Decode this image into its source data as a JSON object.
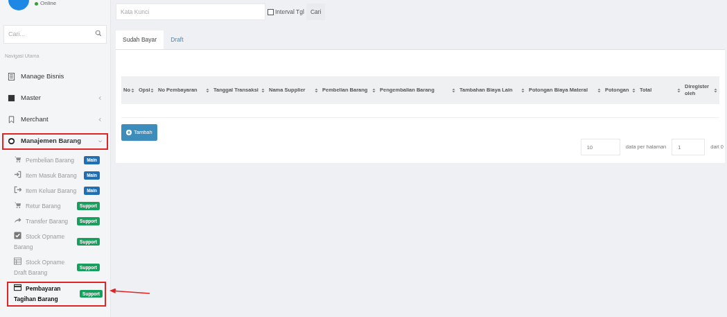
{
  "user": {
    "status": "Online"
  },
  "sidebar": {
    "search": {
      "placeholder": "Cari..."
    },
    "section_label": "Navigasi Utama",
    "items": [
      {
        "label": "Manage Bisnis",
        "kind": "link",
        "annotated": false
      },
      {
        "label": "Master",
        "kind": "menu",
        "expanded": false,
        "annotated": false
      },
      {
        "label": "Merchant",
        "kind": "menu",
        "expanded": false,
        "annotated": false
      },
      {
        "label": "Manajemen Barang",
        "kind": "menu",
        "expanded": true,
        "annotated": true,
        "children": [
          {
            "label": "Pembelian Barang",
            "badge": "Main",
            "color": "#1f6fb2",
            "selected": false,
            "annotated": false
          },
          {
            "label": "Item Masuk Barang",
            "badge": "Main",
            "color": "#1f6fb2",
            "selected": false,
            "annotated": false
          },
          {
            "label": "Item Keluar Barang",
            "badge": "Main",
            "color": "#1f6fb2",
            "selected": false,
            "annotated": false
          },
          {
            "label": "Retur Barang",
            "badge": "Support",
            "color": "#17a05d",
            "selected": false,
            "annotated": false
          },
          {
            "label": "Transfer Barang",
            "badge": "Support",
            "color": "#17a05d",
            "selected": false,
            "annotated": false
          },
          {
            "label": "Stock Opname Barang",
            "badge": "Support",
            "color": "#17a05d",
            "selected": false,
            "annotated": false
          },
          {
            "label": "Stock Opname Draft Barang",
            "badge": "Support",
            "color": "#17a05d",
            "selected": false,
            "annotated": false
          },
          {
            "label": "Pembayaran Tagihan Barang",
            "badge": "Support",
            "color": "#17a05d",
            "selected": true,
            "annotated": true
          }
        ]
      }
    ]
  },
  "filter": {
    "keyword_placeholder": "Kata Kunci",
    "interval": {
      "label": "Interval Tgl",
      "checked": false
    },
    "search_button": "Cari"
  },
  "tabs": [
    {
      "label": "Sudah Bayar",
      "selected": true
    },
    {
      "label": "Draft",
      "selected": false
    }
  ],
  "table": {
    "columns": [
      "No",
      "Opsi",
      "No Pembayaran",
      "Tanggal Transaksi",
      "Nama Supplier",
      "Pembelian Barang",
      "Pengembalian Barang",
      "Tambahan Biaya Lain",
      "Potongan Biaya Materal",
      "Potongan",
      "Total",
      "Diregister oleh"
    ]
  },
  "add_button": "Tambah",
  "pagination": {
    "page_size": "10",
    "per_page_label": "data per halaman",
    "page": "1",
    "total_label": "dari 0"
  }
}
